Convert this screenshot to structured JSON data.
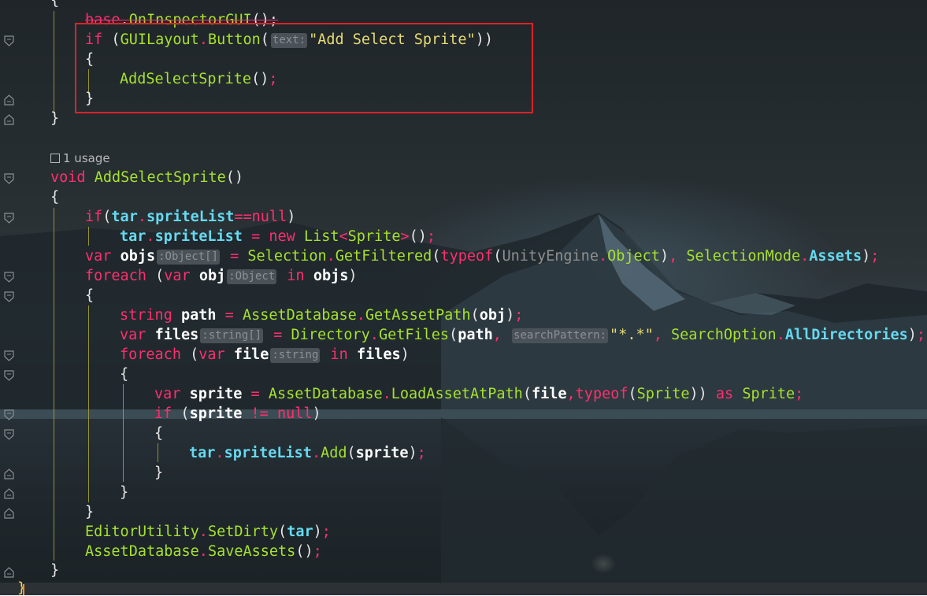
{
  "editor": {
    "theme_colors": {
      "keyword": "#ff2f6e",
      "function": "#a6e22e",
      "field": "#66d9ef",
      "string": "#e6db74",
      "highlight_box": "#d9232b"
    },
    "usage_hint": "1 usage",
    "usage_icon": "external-link-icon",
    "lines": {
      "l0": "{",
      "l1_a": "base",
      "l1_b": ".",
      "l1_c": "OnInspectorGUI",
      "l1_d": "();",
      "l2_a": "if",
      "l2_b": " (",
      "l2_c": "GUILayout",
      "l2_d": ".",
      "l2_e": "Button",
      "l2_f": "(",
      "l2_hint": "text:",
      "l2_g": "\"Add Select Sprite\"",
      "l2_h": "))",
      "l3": "{",
      "l4_a": "AddSelectSprite",
      "l4_b": "()",
      "l4_c": ";",
      "l5": "}",
      "l6": "}",
      "l8_a": "void",
      "l8_b": "AddSelectSprite",
      "l8_c": "()",
      "l9": "{",
      "l10_a": "if",
      "l10_b": "(",
      "l10_c": "tar",
      "l10_d": ".",
      "l10_e": "spriteList",
      "l10_f": "==",
      "l10_g": "null",
      "l10_h": ")",
      "l11_a": "tar",
      "l11_b": ".",
      "l11_c": "spriteList",
      "l11_d": " = ",
      "l11_e": "new",
      "l11_f": "List",
      "l11_g": "<",
      "l11_h": "Sprite",
      "l11_i": ">",
      "l11_j": "()",
      "l11_k": ";",
      "l12_a": "var",
      "l12_b": "objs",
      "l12_hint": ":Object[]",
      "l12_c": " = ",
      "l12_d": "Selection",
      "l12_e": ".",
      "l12_f": "GetFiltered",
      "l12_g": "(",
      "l12_h": "typeof",
      "l12_i": "(",
      "l12_j": "UnityEngine",
      "l12_k": ".",
      "l12_l": "Object",
      "l12_m": ")",
      "l12_n": ", ",
      "l12_o": "SelectionMode",
      "l12_p": ".",
      "l12_q": "Assets",
      "l12_r": ")",
      "l12_s": ";",
      "l13_a": "foreach",
      "l13_b": " (",
      "l13_c": "var",
      "l13_d": "obj",
      "l13_hint": ":Object",
      "l13_e": "in",
      "l13_f": "objs",
      "l13_g": ")",
      "l14": "{",
      "l15_a": "string",
      "l15_b": "path",
      "l15_c": " = ",
      "l15_d": "AssetDatabase",
      "l15_e": ".",
      "l15_f": "GetAssetPath",
      "l15_g": "(",
      "l15_h": "obj",
      "l15_i": ")",
      "l15_j": ";",
      "l16_a": "var",
      "l16_b": "files",
      "l16_hint": ":string[]",
      "l16_c": " = ",
      "l16_d": "Directory",
      "l16_e": ".",
      "l16_f": "GetFiles",
      "l16_g": "(",
      "l16_h": "path",
      "l16_i": ",",
      "l16_hint2": "searchPattern:",
      "l16_j": "\"*.*\"",
      "l16_k": ", ",
      "l16_l": "SearchOption",
      "l16_m": ".",
      "l16_n": "AllDirectories",
      "l16_o": ")",
      "l16_p": ";",
      "l17_a": "foreach",
      "l17_b": " (",
      "l17_c": "var",
      "l17_d": "file",
      "l17_hint": ":string",
      "l17_e": "in",
      "l17_f": "files",
      "l17_g": ")",
      "l18": "{",
      "l19_a": "var",
      "l19_b": "sprite",
      "l19_c": " = ",
      "l19_d": "AssetDatabase",
      "l19_e": ".",
      "l19_f": "LoadAssetAtPath",
      "l19_g": "(",
      "l19_h": "file",
      "l19_i": ",",
      "l19_j": "typeof",
      "l19_k": "(",
      "l19_l": "Sprite",
      "l19_m": "))",
      "l19_n": " as ",
      "l19_o": "Sprite",
      "l19_p": ";",
      "l20_a": "if",
      "l20_b": " (",
      "l20_c": "sprite",
      "l20_d": " != ",
      "l20_e": "null",
      "l20_f": ")",
      "l21": "{",
      "l22_a": "tar",
      "l22_b": ".",
      "l22_c": "spriteList",
      "l22_d": ".",
      "l22_e": "Add",
      "l22_f": "(",
      "l22_g": "sprite",
      "l22_h": ")",
      "l22_i": ";",
      "l23": "}",
      "l24": "}",
      "l25": "}",
      "l26_a": "EditorUtility",
      "l26_b": ".",
      "l26_c": "SetDirty",
      "l26_d": "(",
      "l26_e": "tar",
      "l26_f": ")",
      "l26_g": ";",
      "l27_a": "AssetDatabase",
      "l27_b": ".",
      "l27_c": "SaveAssets",
      "l27_d": "()",
      "l27_e": ";",
      "l28": "}",
      "l29": "}"
    }
  }
}
